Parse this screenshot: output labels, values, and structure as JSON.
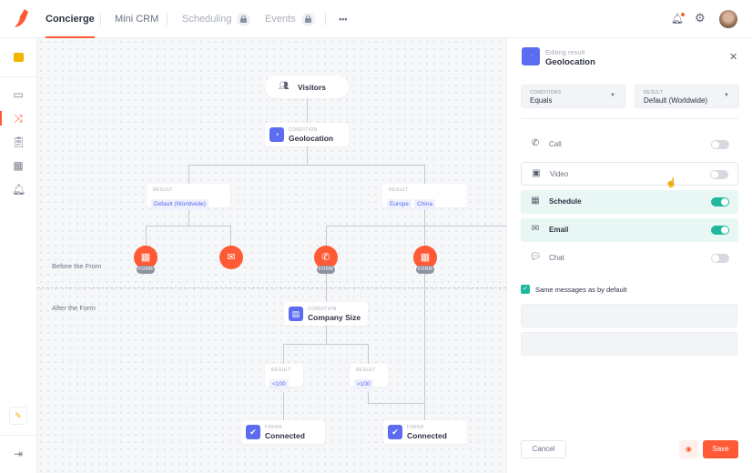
{
  "topbar": {
    "tabs": [
      {
        "label": "Concierge",
        "active": true
      },
      {
        "label": "Mini CRM"
      },
      {
        "label": "Scheduling",
        "locked": true
      },
      {
        "label": "Events",
        "locked": true
      }
    ],
    "more": "•••"
  },
  "sidebar": {
    "items": [
      "sticky-note",
      "browser",
      "shuffle",
      "clipboard",
      "calendar",
      "bell"
    ],
    "active": "shuffle"
  },
  "canvas": {
    "visitors": "Visitors",
    "geo": {
      "sub": "CONDITION",
      "title": "Geolocation"
    },
    "result_left": {
      "sub": "RESULT",
      "chips": [
        "Default (Worldwide)"
      ]
    },
    "result_right": {
      "sub": "RESULT",
      "chips": [
        "Europe",
        "China"
      ]
    },
    "form_badge": "FORM",
    "before_label": "Before the From",
    "after_label": "After the Form",
    "company": {
      "sub": "CONDITION",
      "title": "Company Size"
    },
    "res_lt": {
      "sub": "RESULT",
      "chip": "<100"
    },
    "res_gt": {
      "sub": "RESULT",
      "chip": ">100"
    },
    "finish_left": {
      "sub": "FINISH",
      "title": "Connected"
    },
    "finish_right": {
      "sub": "FINISH",
      "title": "Connected"
    }
  },
  "panel": {
    "subtitle": "Editing result",
    "title": "Geolocation",
    "conditions": {
      "label": "CONDITIONS",
      "value": "Equals"
    },
    "result": {
      "label": "RESULT",
      "value": "Default (Worldwide)"
    },
    "channels": [
      {
        "label": "Call",
        "on": false
      },
      {
        "label": "Video",
        "on": false
      },
      {
        "label": "Schedule",
        "on": true
      },
      {
        "label": "Email",
        "on": true
      },
      {
        "label": "Chat",
        "on": false
      }
    ],
    "same_messages": "Same messages as by default",
    "cancel": "Cancel",
    "save": "Save"
  },
  "colors": {
    "accent": "#ff5a36",
    "primary": "#5b6cf0",
    "toggle_on": "#1fb89a"
  }
}
